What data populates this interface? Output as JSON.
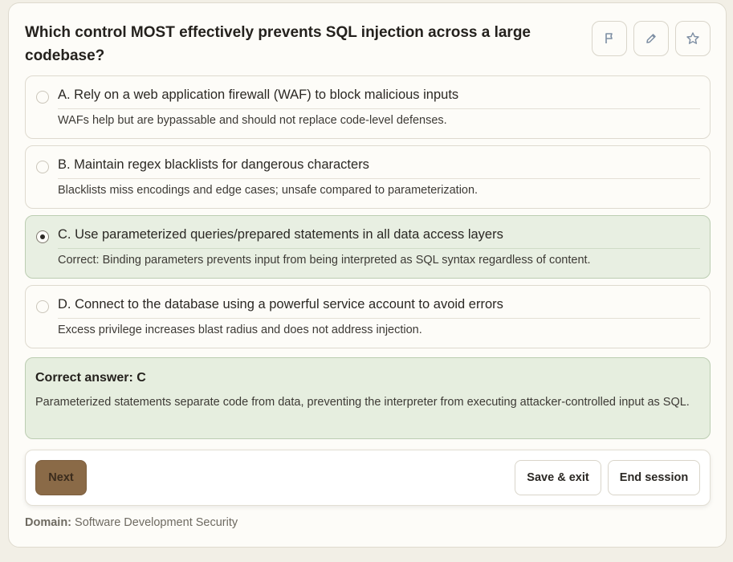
{
  "question": {
    "text": "Which control MOST effectively prevents SQL injection across a large codebase?"
  },
  "toolbar": {
    "flag_icon": "flag-icon",
    "edit_icon": "pencil-icon",
    "star_icon": "star-icon"
  },
  "options": [
    {
      "label": "A. Rely on a web application firewall (WAF) to block malicious inputs",
      "explanation": "WAFs help but are bypassable and should not replace code-level defenses.",
      "selected": false
    },
    {
      "label": "B. Maintain regex blacklists for dangerous characters",
      "explanation": "Blacklists miss encodings and edge cases; unsafe compared to parameterization.",
      "selected": false
    },
    {
      "label": "C. Use parameterized queries/prepared statements in all data access layers",
      "explanation": "Correct: Binding parameters prevents input from being interpreted as SQL syntax regardless of content.",
      "selected": true
    },
    {
      "label": "D. Connect to the database using a powerful service account to avoid errors",
      "explanation": "Excess privilege increases blast radius and does not address injection.",
      "selected": false
    }
  ],
  "answer": {
    "title": "Correct answer: C",
    "body": "Parameterized statements separate code from data, preventing the interpreter from executing attacker-controlled input as SQL."
  },
  "actions": {
    "next_label": "Next",
    "save_label": "Save & exit",
    "end_label": "End session"
  },
  "footer": {
    "domain_label": "Domain:",
    "domain_value": "Software Development Security"
  },
  "colors": {
    "correct_bg": "#e6eedf",
    "next_button": "#8a6a47",
    "page_bg": "#f2efe6"
  }
}
